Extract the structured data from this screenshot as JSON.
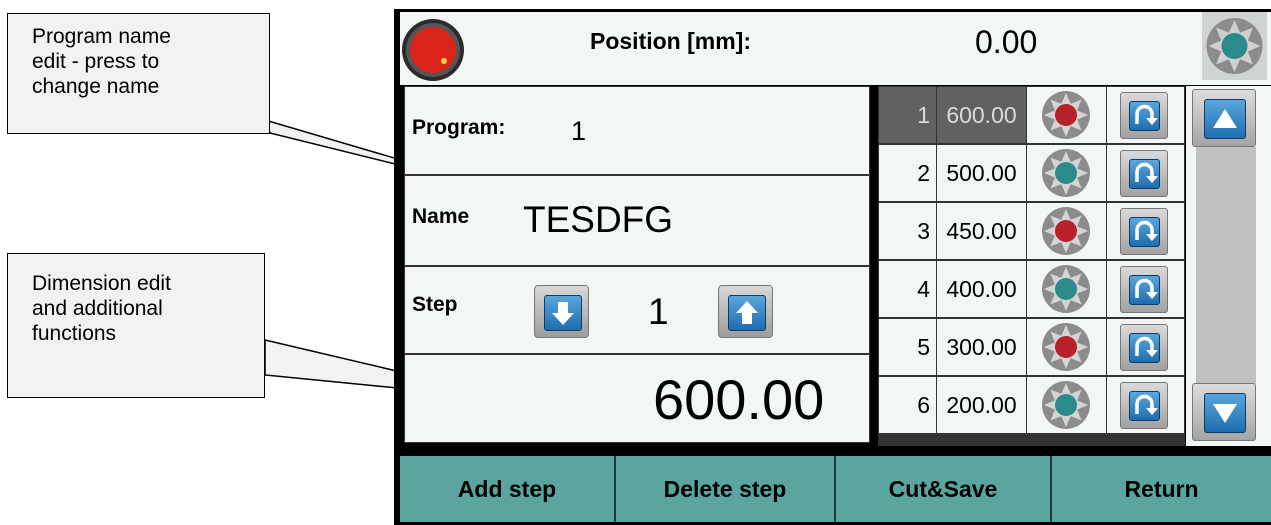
{
  "callouts": {
    "program_name": [
      "Program name",
      "edit - press to",
      "change name"
    ],
    "dimension": [
      "Dimension edit",
      "and additional",
      "functions"
    ]
  },
  "header": {
    "position_label": "Position  [mm]:",
    "position_value": "0.00"
  },
  "program": {
    "label": "Program:",
    "value": "1"
  },
  "name": {
    "label": "Name",
    "value": "TESDFG"
  },
  "step": {
    "label": "Step",
    "value": "1"
  },
  "dimension": {
    "value": "600.00"
  },
  "steps": [
    {
      "num": "1",
      "value": "600.00",
      "fan": "red",
      "selected": true
    },
    {
      "num": "2",
      "value": "500.00",
      "fan": "teal",
      "selected": false
    },
    {
      "num": "3",
      "value": "450.00",
      "fan": "red",
      "selected": false
    },
    {
      "num": "4",
      "value": "400.00",
      "fan": "teal",
      "selected": false
    },
    {
      "num": "5",
      "value": "300.00",
      "fan": "red",
      "selected": false
    },
    {
      "num": "6",
      "value": "200.00",
      "fan": "teal",
      "selected": false
    }
  ],
  "buttons": {
    "add_step": "Add step",
    "delete_step": "Delete step",
    "cut_save": "Cut&Save",
    "return": "Return"
  },
  "icons": {
    "status_led": "status-led-icon",
    "fan": "fan-icon",
    "return": "return-arrow-icon",
    "step_down": "arrow-down-icon",
    "step_up": "arrow-up-icon",
    "scroll_up": "triangle-up-icon",
    "scroll_down": "triangle-down-icon"
  },
  "colors": {
    "panel_bg": "#f3f7f4",
    "bottom_button": "#5aa5a0",
    "selected_row": "#616161",
    "button_blue": "#1f6dae",
    "fan_red": "#b8202a",
    "fan_teal": "#2d8a8a",
    "led_red": "#d9241c"
  }
}
